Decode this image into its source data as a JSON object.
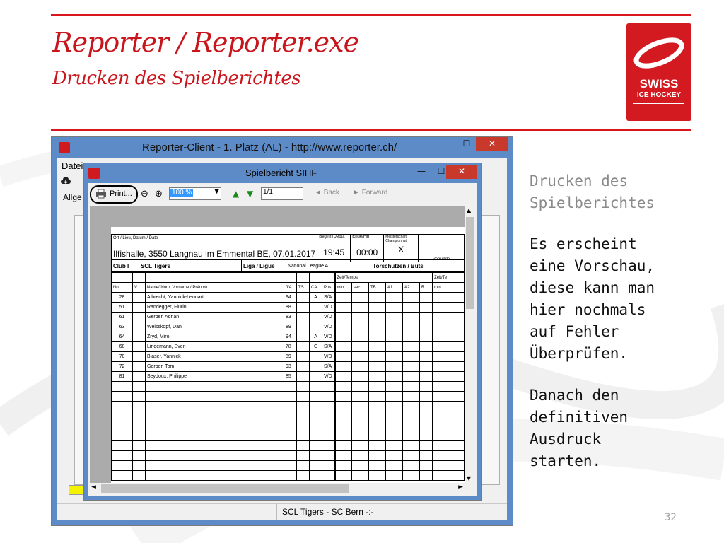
{
  "slide": {
    "title": "Reporter / Reporter.exe",
    "subtitle": "Drucken des Spielberichtes",
    "page_number": "32",
    "colors": {
      "accent": "#d9161d",
      "window_frame": "#5d8bc7"
    }
  },
  "logo": {
    "line1": "SWISS",
    "line2": "ICE HOCKEY"
  },
  "sidebar": {
    "heading": "Drucken des\nSpielberichtes",
    "paragraph1": "Es erscheint\neine Vorschau,\ndiese kann man\nhier nochmals\nauf Fehler\nÜberprüfen.",
    "paragraph2": "Danach den\ndefinitiven\nAusdruck\nstarten."
  },
  "main_window": {
    "title": "Reporter-Client  -  1. Platz (AL)  -  http://www.reporter.ch/",
    "menu_visible": "Datei",
    "tab_visible": "Allge",
    "status_text": "SCL Tigers - SC Bern -:-",
    "buttons": {
      "minimize": "—",
      "maximize": "☐",
      "close": "✕"
    }
  },
  "preview_window": {
    "title": "Spielbericht SIHF",
    "buttons": {
      "minimize": "—",
      "maximize": "☐",
      "close": "✕"
    },
    "toolbar": {
      "print_label": "Print...",
      "zoom_value": "100 %",
      "page_value": "1/1",
      "back_label": "Back",
      "forward_label": "Forward"
    }
  },
  "report": {
    "header": {
      "location_label": "Ort / Lieu, Datum / Date",
      "location_value": "Ilfishalle, 3550 Langnau im Emmental BE, 07.01.2017",
      "start_label": "Beginn/Début",
      "start_value": "19:45",
      "end_label": "Ende/Fin",
      "end_value": "00:00",
      "championship_label": "Meisterschaft Championnat",
      "championship_value": "X",
      "vorrunde_label": "Vorrunde"
    },
    "club": {
      "club_label": "Club I",
      "club_name": "SCL Tigers",
      "league_label": "Liga / Ligue",
      "league_value": "National League A",
      "scorers_label": "Torschützen / Buts"
    },
    "columns": [
      "No.",
      "V",
      "Name/ Nom, Vorname / Prénom",
      "J/A",
      "TS",
      "CA",
      "Pos"
    ],
    "time_label": "Zeit/Temps",
    "time_label_right": "Zeit/Te",
    "scorer_columns": [
      "min.",
      "sec",
      "TB",
      "A1",
      "A2",
      "R",
      "min."
    ],
    "players": [
      {
        "no": "28",
        "name": "Albrecht, Yannick-Lennart",
        "ja": "94",
        "ts": "",
        "ca": "A",
        "pos": "S/A"
      },
      {
        "no": "51",
        "name": "Randegger, Flurin",
        "ja": "88",
        "ts": "",
        "ca": "",
        "pos": "V/D"
      },
      {
        "no": "61",
        "name": "Gerber, Adrian",
        "ja": "83",
        "ts": "",
        "ca": "",
        "pos": "V/D"
      },
      {
        "no": "63",
        "name": "Weisskopf, Dan",
        "ja": "89",
        "ts": "",
        "ca": "",
        "pos": "V/D"
      },
      {
        "no": "64",
        "name": "Zryd, Miro",
        "ja": "94",
        "ts": "",
        "ca": "A",
        "pos": "V/D"
      },
      {
        "no": "68",
        "name": "Lindemann, Sven",
        "ja": "78",
        "ts": "",
        "ca": "C",
        "pos": "S/A"
      },
      {
        "no": "70",
        "name": "Blaser, Yannick",
        "ja": "89",
        "ts": "",
        "ca": "",
        "pos": "V/D"
      },
      {
        "no": "72",
        "name": "Gerber, Tom",
        "ja": "93",
        "ts": "",
        "ca": "",
        "pos": "S/A"
      },
      {
        "no": "81",
        "name": "Seydoux, Philippe",
        "ja": "85",
        "ts": "",
        "ca": "",
        "pos": "V/D"
      }
    ],
    "empty_rows": 10
  }
}
